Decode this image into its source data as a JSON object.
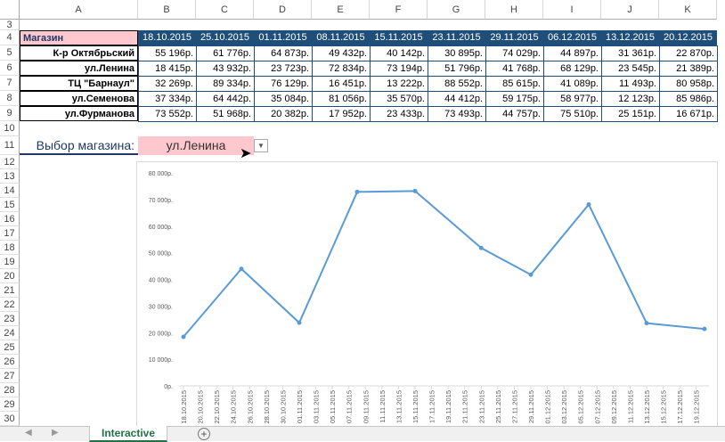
{
  "columns": [
    "A",
    "B",
    "C",
    "D",
    "E",
    "F",
    "G",
    "H",
    "I",
    "J",
    "K"
  ],
  "rows": [
    "3",
    "4",
    "5",
    "6",
    "7",
    "8",
    "9",
    "10",
    "11",
    "12",
    "13",
    "14",
    "15",
    "16",
    "17",
    "18",
    "19",
    "20",
    "21",
    "22",
    "23",
    "24",
    "25",
    "26",
    "27",
    "28",
    "29",
    "30"
  ],
  "table": {
    "header_label": "Магазин",
    "dates": [
      "18.10.2015",
      "25.10.2015",
      "01.11.2015",
      "08.11.2015",
      "15.11.2015",
      "23.11.2015",
      "29.11.2015",
      "06.12.2015",
      "13.12.2015",
      "20.12.2015"
    ],
    "stores": [
      {
        "name": "К-р Октябрьский",
        "values": [
          "55 196р.",
          "61 776р.",
          "64 873р.",
          "49 432р.",
          "40 142р.",
          "30 895р.",
          "74 029р.",
          "44 897р.",
          "31 361р.",
          "22 870р."
        ]
      },
      {
        "name": "ул.Ленина",
        "values": [
          "18 415р.",
          "43 932р.",
          "23 723р.",
          "72 834р.",
          "73 194р.",
          "51 796р.",
          "41 768р.",
          "68 129р.",
          "23 545р.",
          "21 389р."
        ]
      },
      {
        "name": "ТЦ \"Барнаул\"",
        "values": [
          "32 269р.",
          "89 334р.",
          "76 129р.",
          "16 451р.",
          "13 222р.",
          "88 552р.",
          "85 615р.",
          "41 089р.",
          "11 493р.",
          "80 958р."
        ]
      },
      {
        "name": "ул.Семенова",
        "values": [
          "37 334р.",
          "64 442р.",
          "35 084р.",
          "81 056р.",
          "35 570р.",
          "44 412р.",
          "59 175р.",
          "58 977р.",
          "12 123р.",
          "85 986р."
        ]
      },
      {
        "name": "ул.Фурманова",
        "values": [
          "73 552р.",
          "51 968р.",
          "20 382р.",
          "17 952р.",
          "23 433р.",
          "73 493р.",
          "44 757р.",
          "75 510р.",
          "25 151р.",
          "16 671р."
        ]
      }
    ]
  },
  "selector": {
    "label": "Выбор магазина:",
    "value": "ул.Ленина"
  },
  "chart_data": {
    "type": "line",
    "series": [
      {
        "name": "ул.Ленина",
        "x": [
          "18.10.2015",
          "25.10.2015",
          "01.11.2015",
          "08.11.2015",
          "15.11.2015",
          "23.11.2015",
          "29.11.2015",
          "06.12.2015",
          "13.12.2015",
          "20.12.2015"
        ],
        "day_offsets": [
          0,
          7,
          14,
          21,
          28,
          36,
          42,
          49,
          56,
          63
        ],
        "values": [
          18415,
          43932,
          23723,
          72834,
          73194,
          51796,
          41768,
          68129,
          23545,
          21389
        ]
      }
    ],
    "y_ticks": [
      "0р.",
      "10 000р.",
      "20 000р.",
      "30 000р.",
      "40 000р.",
      "50 000р.",
      "60 000р.",
      "70 000р.",
      "80 000р."
    ],
    "ylim": [
      0,
      80000
    ],
    "x_ticks": [
      "18.10.2015",
      "20.10.2015",
      "22.10.2015",
      "24.10.2015",
      "26.10.2015",
      "28.10.2015",
      "30.10.2015",
      "01.11.2015",
      "03.11.2015",
      "05.11.2015",
      "07.11.2015",
      "09.11.2015",
      "11.11.2015",
      "13.11.2015",
      "15.11.2015",
      "17.11.2015",
      "19.11.2015",
      "21.11.2015",
      "23.11.2015",
      "25.11.2015",
      "27.11.2015",
      "29.11.2015",
      "01.12.2015",
      "03.12.2015",
      "05.12.2015",
      "07.12.2015",
      "09.12.2015",
      "11.12.2015",
      "13.12.2015",
      "15.12.2015",
      "17.12.2015",
      "19.12.2015"
    ],
    "line_color": "#5b9bd5"
  },
  "tabs": {
    "active": "Interactive"
  }
}
